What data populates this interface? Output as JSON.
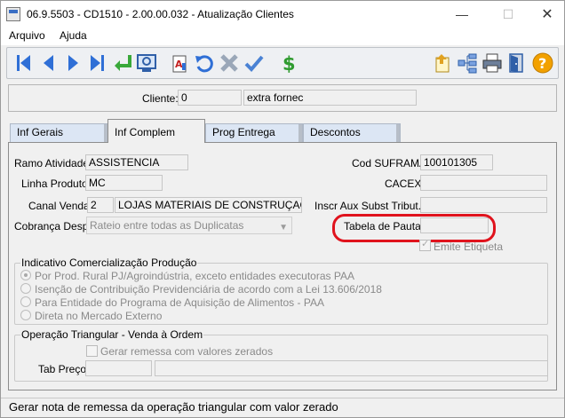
{
  "window": {
    "title": "06.9.5503 - CD1510 - 2.00.00.032 - Atualização Clientes",
    "minimize": "—",
    "maximize": "☐",
    "close": "✕"
  },
  "menu": {
    "items": [
      "Arquivo",
      "Ajuda"
    ]
  },
  "toolbar": {
    "buttons": [
      "first-record-icon",
      "previous-record-icon",
      "next-record-icon",
      "last-record-icon",
      "select-return-icon",
      "search-screen-icon",
      "edit-text-icon",
      "undo-icon",
      "delete-icon",
      "confirm-icon",
      "dollar-icon",
      "import-icon",
      "tree-icon",
      "print-icon",
      "exit-door-icon",
      "help-icon"
    ]
  },
  "client": {
    "label": "Cliente:",
    "code": "0",
    "name": "extra fornec"
  },
  "tabs": [
    "Inf Gerais",
    "Inf Complem",
    "Prog Entrega",
    "Descontos"
  ],
  "form": {
    "ramo_label": "Ramo Atividade:",
    "ramo_value": "ASSISTENCIA",
    "linha_label": "Linha Produto:",
    "linha_value": "MC",
    "canal_label": "Canal Venda:",
    "canal_code": "2",
    "canal_name": "LOJAS MATERIAIS DE CONSTRUÇAO",
    "cobranca_label": "Cobrança Desp:",
    "cobranca_value": "Rateio entre todas as Duplicatas",
    "suframa_label": "Cod SUFRAMA:",
    "suframa_value": "100101305",
    "cacex_label": "CACEX:",
    "cacex_value": "",
    "inscr_label": "Inscr Aux Subst Tribut.:",
    "inscr_value": "",
    "pauta_label": "Tabela de Pauta:",
    "pauta_value": "",
    "emite_label": "Emite Etiqueta"
  },
  "indicativo": {
    "title": "Indicativo Comercialização Produção",
    "options": [
      "Por Prod. Rural PJ/Agroindústria, exceto entidades executoras PAA",
      "Isenção de Contribuição Previdenciária de acordo com a Lei 13.606/2018",
      "Para Entidade do Programa de Aquisição de Alimentos - PAA",
      "Direta no Mercado Externo"
    ]
  },
  "triangular": {
    "title": "Operação Triangular - Venda à Ordem",
    "gerar_label": "Gerar remessa com valores zerados",
    "tab_preco_label": "Tab Preço:"
  },
  "status": {
    "text": "Gerar nota de remessa da operação triangular com valor zerado"
  },
  "colors": {
    "highlight": "#e0131d",
    "tab_inactive": "#dce6f4"
  }
}
